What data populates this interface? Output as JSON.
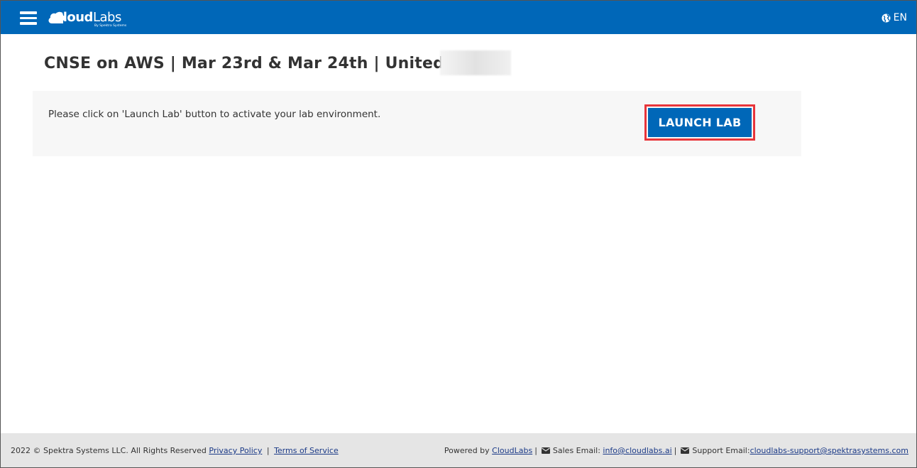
{
  "header": {
    "logo_main": "Cloud",
    "logo_light": "Labs",
    "logo_sub": "By Spektra Systems",
    "language": "EN"
  },
  "page": {
    "title": "CNSE on AWS | Mar 23rd & Mar 24th | United States"
  },
  "panel": {
    "message": "Please click on 'Launch Lab' button to activate your lab environment.",
    "launch_label": "LAUNCH LAB"
  },
  "footer": {
    "copyright": "2022 © Spektra Systems LLC. All Rights Reserved",
    "privacy": "Privacy Policy",
    "sep1": "|",
    "terms": "Terms of Service",
    "powered_by": "Powered by",
    "cloudlabs": "CloudLabs",
    "sep2": "|",
    "sales_label": "Sales Email:",
    "sales_email": "info@cloudlabs.ai",
    "sep3": "|",
    "support_label": "Support Email:",
    "support_email": "cloudlabs-support@spektrasystems.com"
  },
  "colors": {
    "brand_blue": "#0067b8",
    "highlight_red": "#e8353b"
  },
  "icons": {
    "menu": "hamburger-icon",
    "language": "globe-icon",
    "email": "envelope-icon"
  }
}
